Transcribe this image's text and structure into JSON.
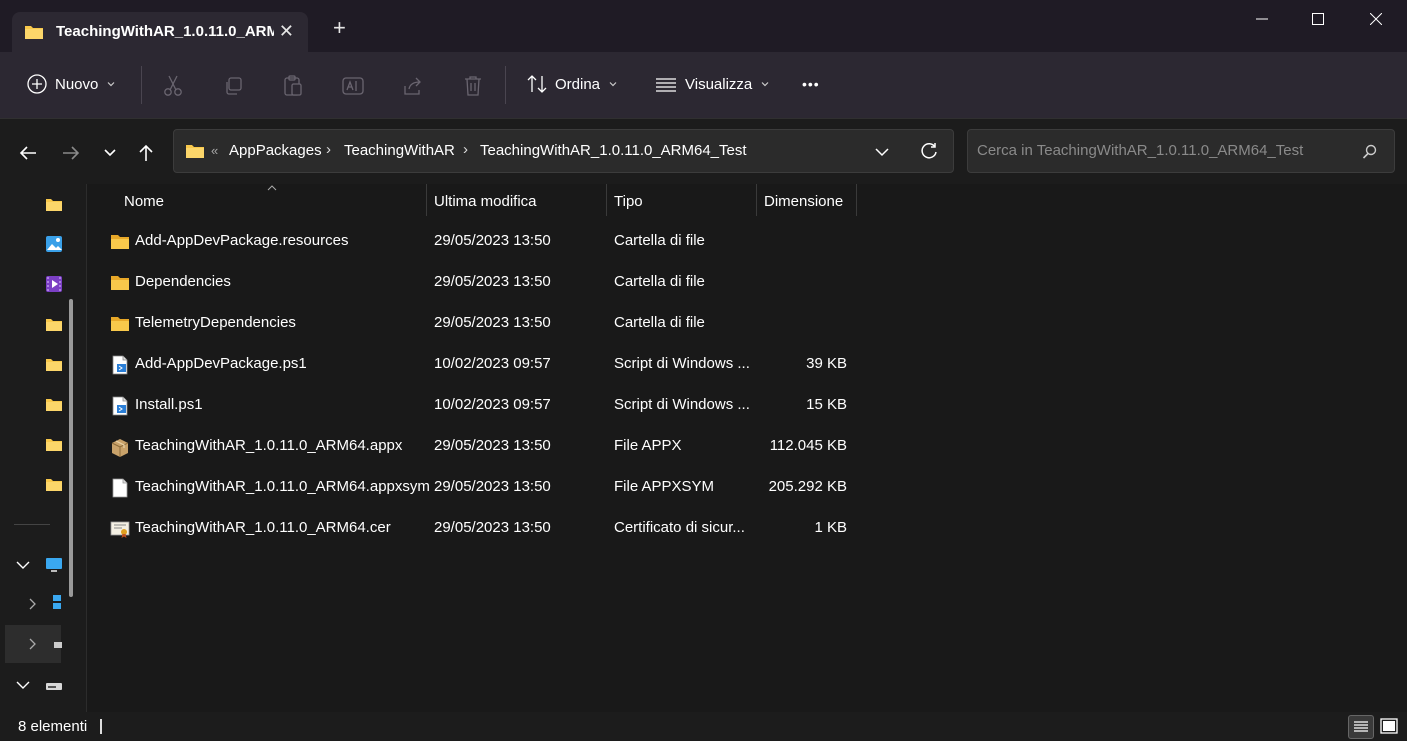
{
  "window": {
    "tab_title": "TeachingWithAR_1.0.11.0_ARM",
    "new_tab": "+",
    "close_tab": "✕"
  },
  "toolbar": {
    "new_label": "Nuovo",
    "sort_label": "Ordina",
    "view_label": "Visualizza",
    "more_label": "•••"
  },
  "address": {
    "overflow": "«",
    "breadcrumbs": [
      "AppPackages",
      "TeachingWithAR",
      "TeachingWithAR_1.0.11.0_ARM64_Test"
    ],
    "separator": "›"
  },
  "search": {
    "placeholder": "Cerca in TeachingWithAR_1.0.11.0_ARM64_Test"
  },
  "columns": {
    "name": "Nome",
    "modified": "Ultima modifica",
    "type": "Tipo",
    "size": "Dimensione"
  },
  "files": [
    {
      "name": "Add-AppDevPackage.resources",
      "modified": "29/05/2023 13:50",
      "type": "Cartella di file",
      "size": "",
      "icon": "folder-icon"
    },
    {
      "name": "Dependencies",
      "modified": "29/05/2023 13:50",
      "type": "Cartella di file",
      "size": "",
      "icon": "folder-icon"
    },
    {
      "name": "TelemetryDependencies",
      "modified": "29/05/2023 13:50",
      "type": "Cartella di file",
      "size": "",
      "icon": "folder-icon"
    },
    {
      "name": "Add-AppDevPackage.ps1",
      "modified": "10/02/2023 09:57",
      "type": "Script di Windows ...",
      "size": "39 KB",
      "icon": "script-file-icon"
    },
    {
      "name": "Install.ps1",
      "modified": "10/02/2023 09:57",
      "type": "Script di Windows ...",
      "size": "15 KB",
      "icon": "script-file-icon"
    },
    {
      "name": "TeachingWithAR_1.0.11.0_ARM64.appx",
      "modified": "29/05/2023 13:50",
      "type": "File APPX",
      "size": "112.045 KB",
      "icon": "package-icon"
    },
    {
      "name": "TeachingWithAR_1.0.11.0_ARM64.appxsym",
      "modified": "29/05/2023 13:50",
      "type": "File APPXSYM",
      "size": "205.292 KB",
      "icon": "blank-file-icon"
    },
    {
      "name": "TeachingWithAR_1.0.11.0_ARM64.cer",
      "modified": "29/05/2023 13:50",
      "type": "Certificato di sicur...",
      "size": "1 KB",
      "icon": "certificate-icon"
    }
  ],
  "status": {
    "count": "8 elementi"
  },
  "colors": {
    "folder": "#f8c84b",
    "titlebar": "#1f1b25",
    "toolbar": "#2c2832",
    "content": "#191919"
  }
}
